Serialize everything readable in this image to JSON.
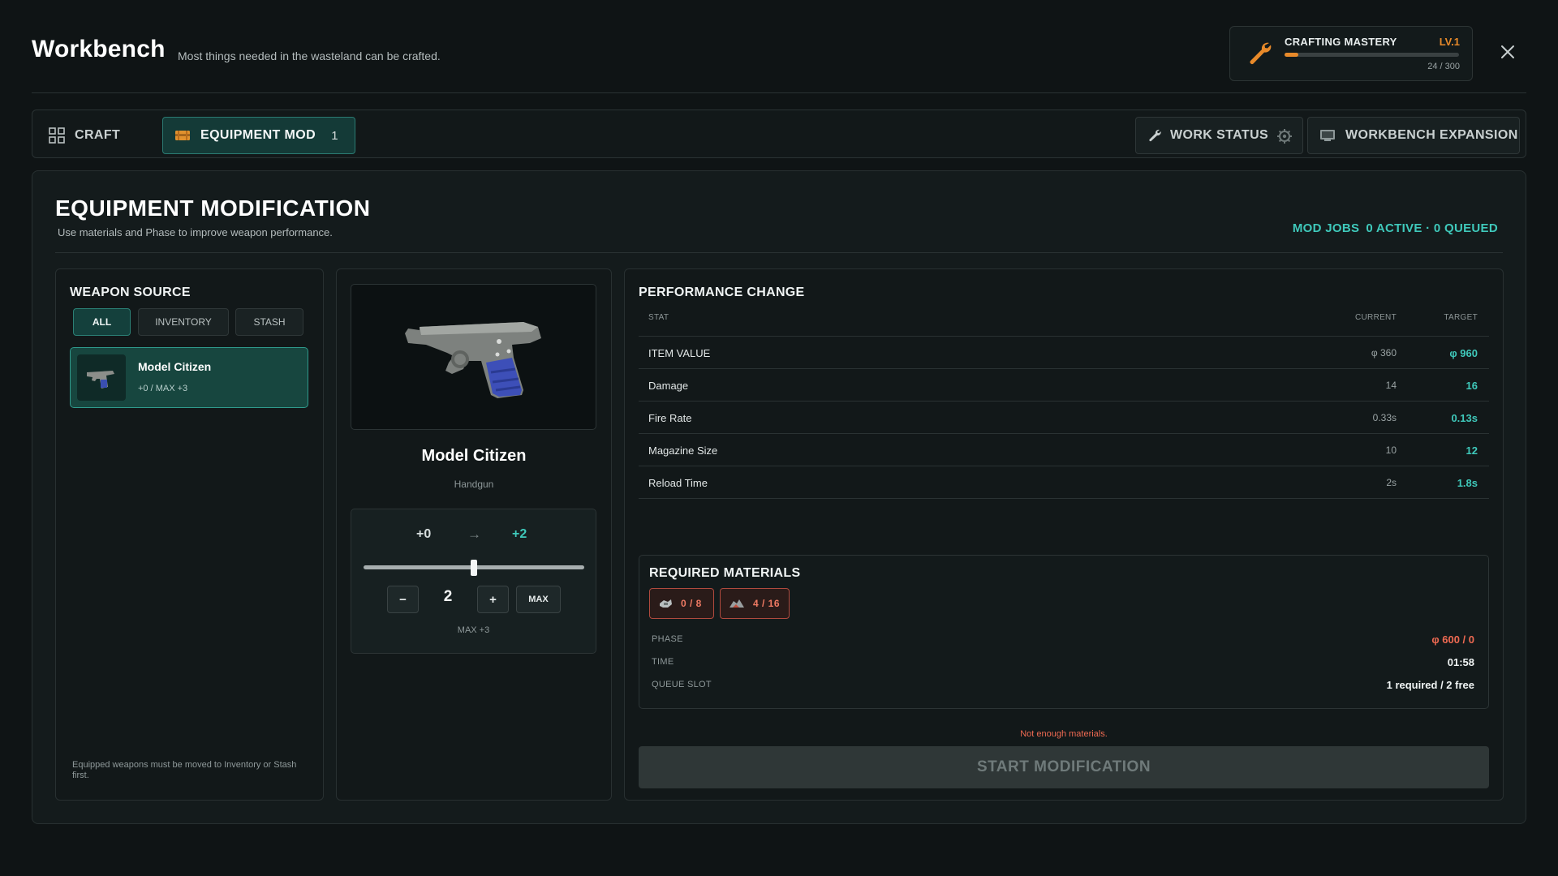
{
  "header": {
    "title": "Workbench",
    "subtitle": "Most things needed in the wasteland can be crafted."
  },
  "mastery": {
    "label": "CRAFTING MASTERY",
    "level": "LV.1",
    "progress_text": "24 / 300",
    "progress": 0.08,
    "icon": "wrench-icon",
    "accent_color": "#e88a2a"
  },
  "tabs": {
    "craft": {
      "label": "CRAFT",
      "icon": "grid-icon"
    },
    "equipment_mod": {
      "label": "EQUIPMENT MOD",
      "count": "1",
      "icon": "crate-icon"
    },
    "work_status": {
      "label": "WORK STATUS",
      "icon": "wrench-icon"
    },
    "workbench_expansion": {
      "label": "WORKBENCH EXPANSION",
      "icon": "monitor-icon"
    }
  },
  "main": {
    "title": "EQUIPMENT MODIFICATION",
    "description": "Use materials and Phase to improve weapon performance.",
    "mod_jobs": {
      "label": "MOD JOBS",
      "status": "0 ACTIVE · 0 QUEUED"
    }
  },
  "source": {
    "title": "WEAPON SOURCE",
    "filters": [
      "ALL",
      "INVENTORY",
      "STASH"
    ],
    "selected_filter": "ALL",
    "weapons": [
      {
        "name": "Model Citizen",
        "level": "+0 / MAX +3"
      }
    ],
    "note": "Equipped weapons must be moved to Inventory or Stash first."
  },
  "weapon": {
    "name": "Model Citizen",
    "type": "Handgun",
    "current_level": "+0",
    "arrow": "→",
    "target_level": "+2",
    "quantity": "2",
    "slider_level": 2,
    "slider_max": 3,
    "minus_label": "−",
    "plus_label": "+",
    "max_label": "MAX",
    "max_text": "MAX +3"
  },
  "performance": {
    "title": "PERFORMANCE CHANGE",
    "columns": {
      "stat": "STAT",
      "current": "CURRENT",
      "target": "TARGET"
    },
    "rows": [
      {
        "stat": "ITEM VALUE",
        "current": "φ 360",
        "target": "φ 960"
      },
      {
        "stat": "Damage",
        "current": "14",
        "target": "16"
      },
      {
        "stat": "Fire Rate",
        "current": "0.33s",
        "target": "0.13s"
      },
      {
        "stat": "Magazine Size",
        "current": "10",
        "target": "12"
      },
      {
        "stat": "Reload Time",
        "current": "2s",
        "target": "1.8s"
      }
    ]
  },
  "materials": {
    "title": "REQUIRED MATERIALS",
    "items": [
      {
        "icon": "parts-icon",
        "qty": "0 / 8"
      },
      {
        "icon": "scrap-icon",
        "qty": "4 / 16"
      }
    ],
    "phase_label": "PHASE",
    "phase_value": "φ 600 / 0",
    "time_label": "TIME",
    "time_value": "01:58",
    "queue_label": "QUEUE SLOT",
    "queue_value": "1 required / 2 free"
  },
  "warning": "Not enough materials.",
  "start_button": "START MODIFICATION",
  "colors": {
    "accent_teal": "#3fc9bb",
    "warning_red": "#ef6a52",
    "background": "#0f1415"
  }
}
